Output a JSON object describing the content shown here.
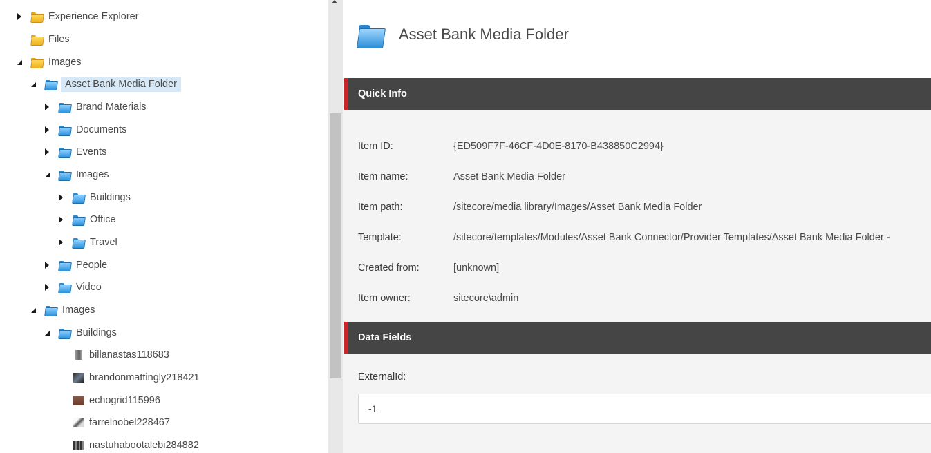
{
  "tree": {
    "items": [
      {
        "label": "Experience Explorer"
      },
      {
        "label": "Files"
      },
      {
        "label": "Images"
      },
      {
        "label": "Asset Bank Media Folder"
      },
      {
        "label": "Brand Materials"
      },
      {
        "label": "Documents"
      },
      {
        "label": "Events"
      },
      {
        "label": "Images"
      },
      {
        "label": "Buildings"
      },
      {
        "label": "Office"
      },
      {
        "label": "Travel"
      },
      {
        "label": "People"
      },
      {
        "label": "Video"
      },
      {
        "label": "Images"
      },
      {
        "label": "Buildings"
      },
      {
        "label": "billanastas118683"
      },
      {
        "label": "brandonmattingly218421"
      },
      {
        "label": "echogrid115996"
      },
      {
        "label": "farrelnobel228467"
      },
      {
        "label": "nastuhabootalebi284882"
      }
    ]
  },
  "content": {
    "title": "Asset Bank Media Folder",
    "quick_info": {
      "heading": "Quick Info",
      "rows": [
        {
          "key": "Item ID:",
          "value": "{ED509F7F-46CF-4D0E-8170-B438850C2994}"
        },
        {
          "key": "Item name:",
          "value": "Asset Bank Media Folder"
        },
        {
          "key": "Item path:",
          "value": "/sitecore/media library/Images/Asset Bank Media Folder"
        },
        {
          "key": "Template:",
          "value": "/sitecore/templates/Modules/Asset Bank Connector/Provider Templates/Asset Bank Media Folder -"
        },
        {
          "key": "Created from:",
          "value": "[unknown]"
        },
        {
          "key": "Item owner:",
          "value": "sitecore\\admin"
        }
      ]
    },
    "data_fields": {
      "heading": "Data Fields",
      "external_id_label": "ExternalId:",
      "external_id_value": "-1"
    }
  }
}
